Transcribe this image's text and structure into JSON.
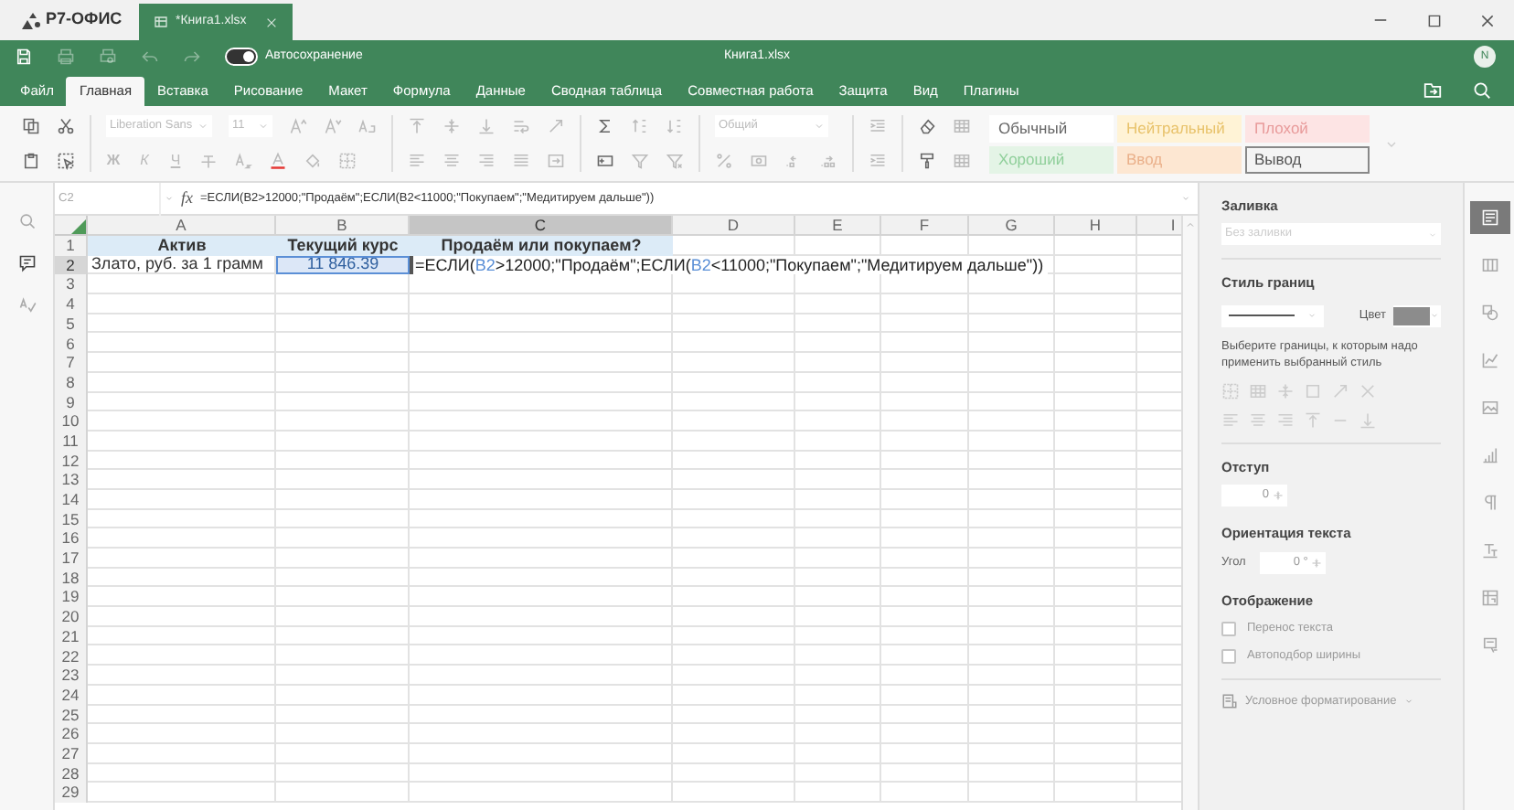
{
  "titlebar": {
    "logo": "Р7-ОФИС",
    "document_tab": "*Книга1.xlsx"
  },
  "header": {
    "autosave": {
      "label": "Автосохранение",
      "on": true
    },
    "title": "Книга1.xlsx",
    "avatar": "N"
  },
  "menu": [
    {
      "label": "Файл",
      "selected": false
    },
    {
      "label": "Главная",
      "selected": true
    },
    {
      "label": "Вставка",
      "selected": false
    },
    {
      "label": "Рисование",
      "selected": false
    },
    {
      "label": "Макет",
      "selected": false
    },
    {
      "label": "Формула",
      "selected": false
    },
    {
      "label": "Данные",
      "selected": false
    },
    {
      "label": "Сводная таблица",
      "selected": false
    },
    {
      "label": "Совместная работа",
      "selected": false
    },
    {
      "label": "Защита",
      "selected": false
    },
    {
      "label": "Вид",
      "selected": false
    },
    {
      "label": "Плагины",
      "selected": false
    }
  ],
  "toolbar": {
    "font": {
      "value": "Liberation Sans",
      "disabled": true
    },
    "size": {
      "value": "11",
      "disabled": true
    },
    "number_format": {
      "value": "Общий",
      "disabled": true
    },
    "format_buttons": [
      "Ж",
      "К",
      "Ч"
    ],
    "cell_styles": [
      {
        "label": "Обычный",
        "kind": "normal"
      },
      {
        "label": "Нейтральный",
        "kind": "neutral"
      },
      {
        "label": "Плохой",
        "kind": "bad"
      },
      {
        "label": "Хороший",
        "kind": "good"
      },
      {
        "label": "Ввод",
        "kind": "input"
      },
      {
        "label": "Вывод",
        "kind": "output"
      }
    ]
  },
  "formula_bar": {
    "cell": "C2",
    "fx_label": "fx",
    "formula": "=ЕСЛИ(B2>12000;\"Продаём\";ЕСЛИ(B2<11000;\"Покупаем\";\"Медитируем дальше\"))"
  },
  "sheet": {
    "columns": [
      {
        "label": "A",
        "selected": false
      },
      {
        "label": "B",
        "selected": false
      },
      {
        "label": "C",
        "selected": true
      },
      {
        "label": "D",
        "selected": false
      },
      {
        "label": "E",
        "selected": false
      },
      {
        "label": "F",
        "selected": false
      },
      {
        "label": "G",
        "selected": false
      },
      {
        "label": "H",
        "selected": false
      },
      {
        "label": "I",
        "selected": false
      }
    ],
    "rows": [
      {
        "label": "1",
        "selected": false
      },
      {
        "label": "2",
        "selected": true
      },
      {
        "label": "3",
        "selected": false
      },
      {
        "label": "4",
        "selected": false
      },
      {
        "label": "5",
        "selected": false
      },
      {
        "label": "6",
        "selected": false
      },
      {
        "label": "7",
        "selected": false
      },
      {
        "label": "8",
        "selected": false
      },
      {
        "label": "9",
        "selected": false
      },
      {
        "label": "10",
        "selected": false
      },
      {
        "label": "11",
        "selected": false
      },
      {
        "label": "12",
        "selected": false
      },
      {
        "label": "13",
        "selected": false
      },
      {
        "label": "14",
        "selected": false
      },
      {
        "label": "15",
        "selected": false
      },
      {
        "label": "16",
        "selected": false
      },
      {
        "label": "17",
        "selected": false
      },
      {
        "label": "18",
        "selected": false
      },
      {
        "label": "19",
        "selected": false
      },
      {
        "label": "20",
        "selected": false
      },
      {
        "label": "21",
        "selected": false
      },
      {
        "label": "22",
        "selected": false
      },
      {
        "label": "23",
        "selected": false
      },
      {
        "label": "24",
        "selected": false
      },
      {
        "label": "25",
        "selected": false
      },
      {
        "label": "26",
        "selected": false
      },
      {
        "label": "27",
        "selected": false
      },
      {
        "label": "28",
        "selected": false
      },
      {
        "label": "29",
        "selected": false
      }
    ],
    "cells": [
      [
        {
          "text": "Актив",
          "kind": "header"
        },
        {
          "text": "Текущий курс",
          "kind": "header"
        },
        {
          "text": "Продаём или покупаем?",
          "kind": "header"
        }
      ],
      [
        {
          "text": "Злато, руб. за 1 грамм",
          "kind": "text"
        },
        {
          "text": "11 846.39",
          "kind": "ref_range"
        },
        {
          "kind": "editing",
          "parts": [
            {
              "text": "=ЕСЛИ(",
              "kind": "plain"
            },
            {
              "text": "B2",
              "kind": "ref"
            },
            {
              "text": ">12000;\"Продаём\";ЕСЛИ(",
              "kind": "plain"
            },
            {
              "text": "B2",
              "kind": "ref"
            },
            {
              "text": "<11000;\"Покупаем\";\"Медитируем дальше\"))",
              "kind": "plain"
            }
          ]
        }
      ]
    ]
  },
  "panel": {
    "fill": {
      "title": "Заливка",
      "value": "Без заливки",
      "disabled": true
    },
    "borders": {
      "title": "Стиль границ",
      "color_label": "Цвет",
      "hint": "Выберите границы, к которым надо применить выбранный стиль"
    },
    "indent": {
      "title": "Отступ",
      "value": "0"
    },
    "orientation": {
      "title": "Ориентация текста",
      "angle_label": "Угол",
      "value": "0 °"
    },
    "display": {
      "title": "Отображение",
      "options": [
        {
          "label": "Перенос текста",
          "checked": false,
          "disabled": true
        },
        {
          "label": "Автоподбор ширины",
          "checked": false,
          "disabled": true
        }
      ]
    },
    "conditional": {
      "label": "Условное форматирование",
      "disabled": true
    }
  },
  "right_tabs": [
    {
      "selected": true
    },
    {
      "selected": false
    },
    {
      "selected": false
    },
    {
      "selected": false
    },
    {
      "selected": false
    },
    {
      "selected": false
    },
    {
      "selected": false
    },
    {
      "selected": false
    },
    {
      "selected": false
    },
    {
      "selected": false
    }
  ]
}
